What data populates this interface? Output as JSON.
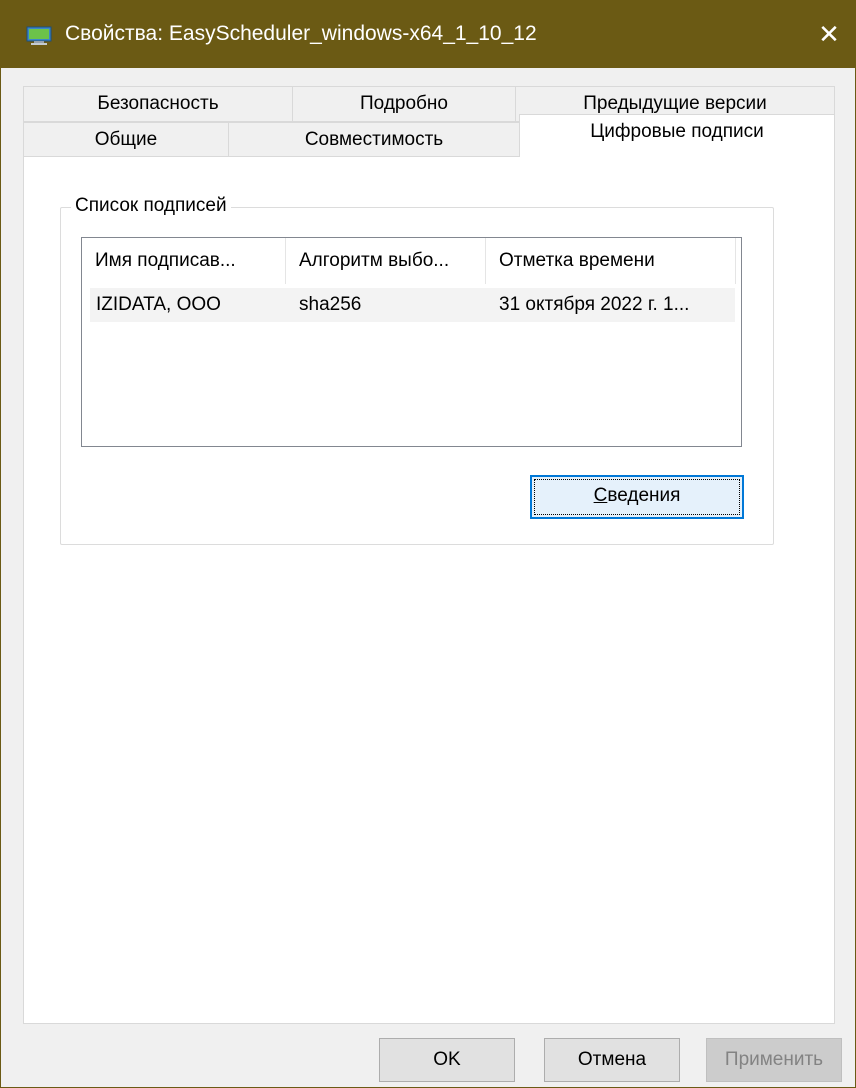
{
  "window": {
    "title": "Свойства: EasyScheduler_windows-x64_1_10_12",
    "close_glyph": "✕",
    "icon": "app-icon"
  },
  "tabs": {
    "row1": [
      {
        "label": "Безопасность"
      },
      {
        "label": "Подробно"
      },
      {
        "label": "Предыдущие версии"
      }
    ],
    "row2": [
      {
        "label": "Общие"
      },
      {
        "label": "Совместимость"
      },
      {
        "label": "Цифровые подписи",
        "active": true
      }
    ]
  },
  "signatures": {
    "group_label": "Список подписей",
    "columns": [
      "Имя подписав...",
      "Алгоритм выбо...",
      "Отметка времени"
    ],
    "rows": [
      {
        "name": "IZIDATA, ООО",
        "algorithm": "sha256",
        "timestamp": "31 октября 2022 г. 1..."
      }
    ],
    "details_button": {
      "label": "Сведения",
      "accelerator": "С"
    }
  },
  "buttons": {
    "ok": "OK",
    "cancel": "Отмена",
    "apply": "Применить",
    "apply_enabled": false
  },
  "colors": {
    "titlebar": "#6b5a14",
    "focus_border": "#0078d7"
  }
}
